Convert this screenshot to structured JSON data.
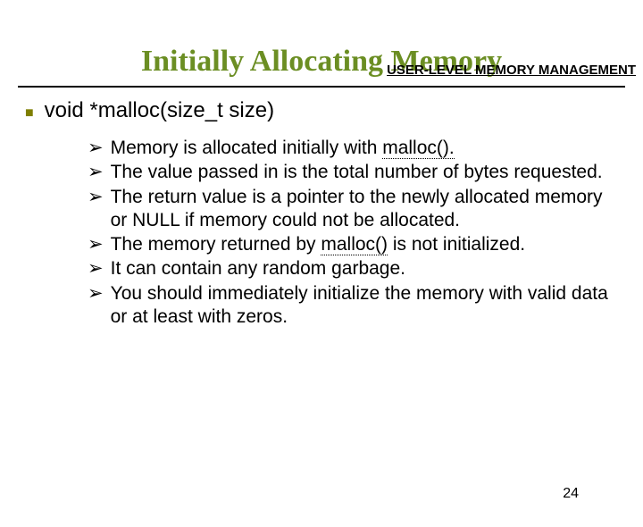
{
  "header": "USER-LEVEL MEMORY MANAGEMENT",
  "title": "Initially Allocating Memory",
  "section_label": "void *malloc(size_t size)",
  "bullets": {
    "b1_a": "Memory is allocated initially with ",
    "b1_u": "malloc().",
    "b2": "The value passed in is the total number of bytes requested.",
    "b3": "The return value is a pointer to the newly allocated memory or NULL if memory could not be allocated.",
    "b4_a": "The memory returned by ",
    "b4_u": "malloc()",
    "b4_b": " is not initialized.",
    "b5": " It can contain any random garbage.",
    "b6": " You should immediately initialize the memory with valid data or at least with zeros."
  },
  "page_number": "24"
}
